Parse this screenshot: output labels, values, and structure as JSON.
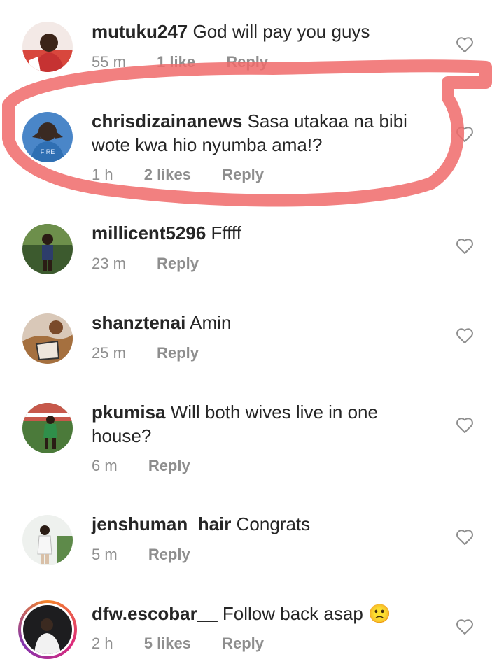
{
  "comments": [
    {
      "username": "mutuku247",
      "text": "God will pay you guys",
      "time": "55 m",
      "likes": "1 like",
      "reply": "Reply"
    },
    {
      "username": "chrisdizainanews",
      "text": "Sasa utakaa na bibi wote kwa hio nyumba ama!?",
      "time": "1 h",
      "likes": "2 likes",
      "reply": "Reply"
    },
    {
      "username": "millicent5296",
      "text": "Fffff",
      "time": "23 m",
      "likes": "",
      "reply": "Reply"
    },
    {
      "username": "shanztenai",
      "text": "Amin",
      "time": "25 m",
      "likes": "",
      "reply": "Reply"
    },
    {
      "username": "pkumisa",
      "text": "Will both wives live in one house?",
      "time": "6 m",
      "likes": "",
      "reply": "Reply"
    },
    {
      "username": "jenshuman_hair",
      "text": "Congrats",
      "time": "5 m",
      "likes": "",
      "reply": "Reply"
    },
    {
      "username": "dfw.escobar__",
      "text": "Follow back asap 🙁",
      "time": "2 h",
      "likes": "5 likes",
      "reply": "Reply"
    }
  ],
  "avatar2_shirt_text": "FIRE",
  "highlight_color": "#f06a6a",
  "icons": {
    "like": "heart-outline-icon"
  }
}
